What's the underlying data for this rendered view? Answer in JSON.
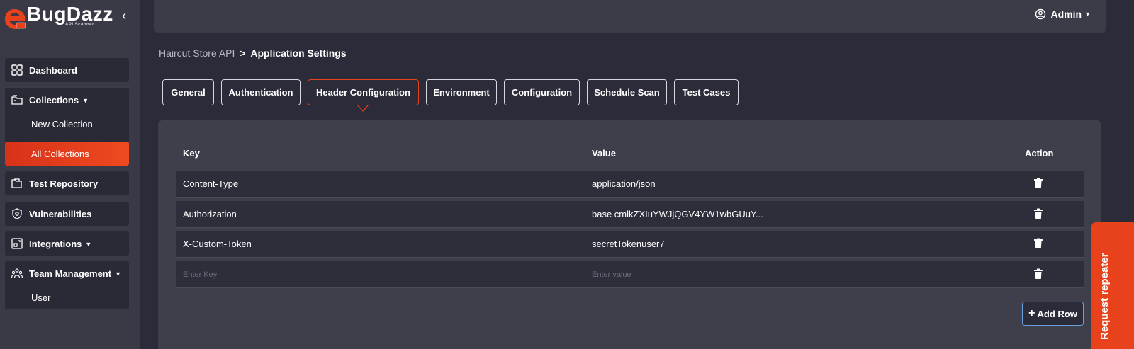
{
  "brand": {
    "name": "BugDazz",
    "subtitle": "API Scanner",
    "badge": "API",
    "accent": "#e8421c"
  },
  "sidebar": {
    "collapse_icon": "chevron-left-icon",
    "items": [
      {
        "label": "Dashboard",
        "icon": "dashboard-grid-icon"
      },
      {
        "label": "Collections",
        "icon": "folder-stack-icon",
        "children": [
          "New Collection",
          "All Collections"
        ],
        "active_child": "All Collections"
      },
      {
        "label": "Test Repository",
        "icon": "folder-files-icon"
      },
      {
        "label": "Vulnerabilities",
        "icon": "shield-icon"
      },
      {
        "label": "Integrations",
        "icon": "integrations-icon"
      },
      {
        "label": "Team Management",
        "icon": "team-icon",
        "children": [
          "User"
        ]
      }
    ]
  },
  "header": {
    "user_label": "Admin",
    "user_icon": "user-circle-icon"
  },
  "breadcrumb": {
    "parent": "Haircut Store API",
    "separator": ">",
    "current": "Application Settings"
  },
  "tabs": [
    {
      "label": "General"
    },
    {
      "label": "Authentication"
    },
    {
      "label": "Header Configuration",
      "active": true
    },
    {
      "label": "Environment"
    },
    {
      "label": "Configuration"
    },
    {
      "label": "Schedule Scan"
    },
    {
      "label": "Test Cases"
    }
  ],
  "table": {
    "headers": {
      "key": "Key",
      "value": "Value",
      "action": "Action"
    },
    "rows": [
      {
        "key": "Content-Type",
        "value": "application/json"
      },
      {
        "key": "Authorization",
        "value": "base cmlkZXIuYWJjQGV4YW1wbGUuY..."
      },
      {
        "key": "X-Custom-Token",
        "value": "secretTokenuser7"
      }
    ],
    "empty_row": {
      "key_placeholder": "Enter Key",
      "value_placeholder": "Enter value"
    },
    "action_icon": "trash-icon"
  },
  "add_row_label": "Add Row",
  "request_repeater_label": "Request repeater"
}
